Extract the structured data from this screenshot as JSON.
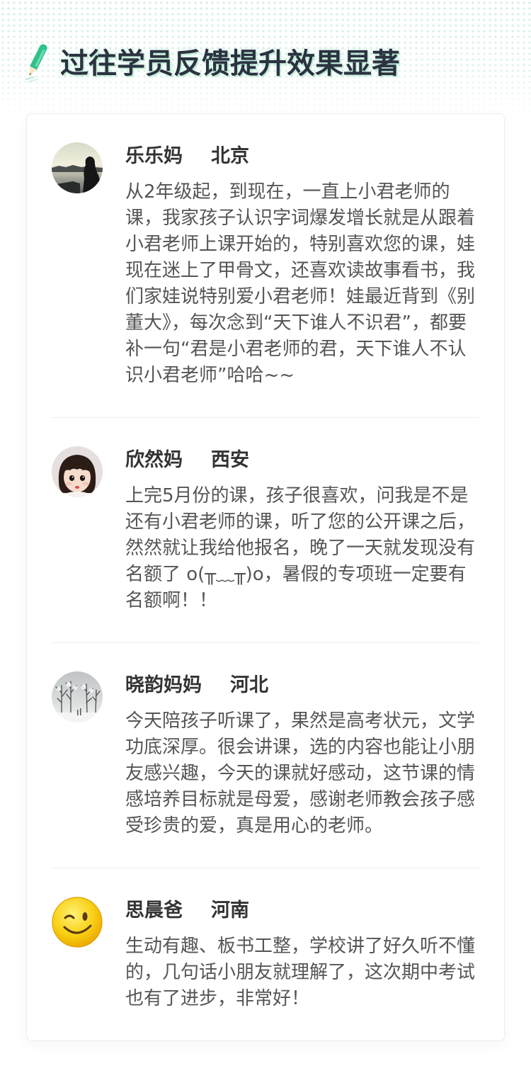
{
  "header": {
    "title": "过往学员反馈提升效果显著",
    "icon": "pencil-icon"
  },
  "colors": {
    "accent": "#2ec28a",
    "title": "#2b3240",
    "name": "#333333",
    "body_text": "#555555",
    "divider": "#eeeeee",
    "dots": "#cdeedf"
  },
  "testimonials": [
    {
      "name": "乐乐妈",
      "city": "北京",
      "lines": [
        "从2年级起，到现在，一直上小君老师的",
        "课，我家孩子认识字词爆发增长就是从跟着",
        "小君老师上课开始的，特别喜欢您的课，娃",
        "现在迷上了甲骨文，还喜欢读故事看书，我",
        "们家娃说特别爱小君老师！娃最近背到《别",
        "董大》，每次念到“天下谁人不识君”，都要",
        "补一句“君是小君老师的君，天下谁人不认",
        "识小君老师”哈哈~~"
      ]
    },
    {
      "name": "欣然妈",
      "city": "西安",
      "lines": [
        "上完5月份的课，孩子很喜欢，问我是不是",
        "还有小君老师的课，听了您的公开课之后，",
        "然然就让我给他报名，晚了一天就发现没有",
        "名额了 o(╥﹏╥)o，暑假的专项班一定要有",
        "名额啊！！"
      ]
    },
    {
      "name": "晓韵妈妈",
      "city": "河北",
      "lines": [
        "今天陪孩子听课了，果然是高考状元，文学",
        "功底深厚。很会讲课，选的内容也能让小朋",
        "友感兴趣，今天的课就好感动，这节课的情",
        "感培养目标就是母爱，感谢老师教会孩子感",
        "受珍贵的爱，真是用心的老师。"
      ]
    },
    {
      "name": "思晨爸",
      "city": "河南",
      "avatar_icon": "winking-face-icon",
      "lines": [
        "生动有趣、板书工整，学校讲了好久听不懂",
        "的，几句话小朋友就理解了，这次期中考试",
        "也有了进步，非常好！"
      ]
    }
  ]
}
